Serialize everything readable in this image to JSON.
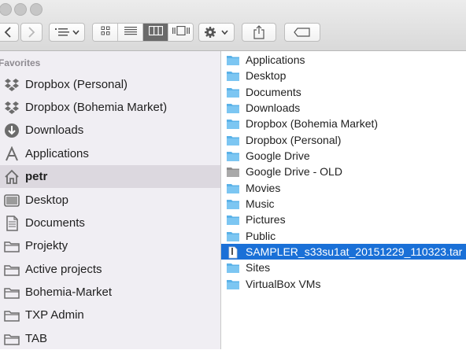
{
  "toolbar": {
    "back_icon": "chevron-left-icon",
    "forward_icon": "chevron-right-icon",
    "arrange_icon": "list-arrange-icon",
    "view_modes": [
      "icon-view",
      "list-view",
      "column-view",
      "cover-flow-view"
    ],
    "active_view": "column-view",
    "action_icon": "gear-icon",
    "share_icon": "share-icon",
    "tag_icon": "tag-icon"
  },
  "sidebar": {
    "section_title": "Favorites",
    "items": [
      {
        "label": "Dropbox (Personal)",
        "icon": "dropbox-icon"
      },
      {
        "label": "Dropbox (Bohemia Market)",
        "icon": "dropbox-icon"
      },
      {
        "label": "Downloads",
        "icon": "download-icon"
      },
      {
        "label": "Applications",
        "icon": "applications-icon"
      },
      {
        "label": "petr",
        "icon": "home-icon",
        "selected": true
      },
      {
        "label": "Desktop",
        "icon": "desktop-icon"
      },
      {
        "label": "Documents",
        "icon": "document-icon"
      },
      {
        "label": "Projekty",
        "icon": "folder-icon"
      },
      {
        "label": "Active projects",
        "icon": "folder-icon"
      },
      {
        "label": "Bohemia-Market",
        "icon": "folder-icon"
      },
      {
        "label": "TXP Admin",
        "icon": "folder-icon"
      },
      {
        "label": "TAB",
        "icon": "folder-icon"
      }
    ]
  },
  "files": [
    {
      "name": "Applications",
      "icon": "folder-icon"
    },
    {
      "name": "Desktop",
      "icon": "folder-icon"
    },
    {
      "name": "Documents",
      "icon": "folder-icon"
    },
    {
      "name": "Downloads",
      "icon": "folder-icon"
    },
    {
      "name": "Dropbox (Bohemia Market)",
      "icon": "folder-icon"
    },
    {
      "name": "Dropbox (Personal)",
      "icon": "folder-icon"
    },
    {
      "name": "Google Drive",
      "icon": "folder-icon"
    },
    {
      "name": "Google Drive - OLD",
      "icon": "folder-gray-icon"
    },
    {
      "name": "Movies",
      "icon": "folder-icon"
    },
    {
      "name": "Music",
      "icon": "folder-icon"
    },
    {
      "name": "Pictures",
      "icon": "folder-icon"
    },
    {
      "name": "Public",
      "icon": "folder-icon"
    },
    {
      "name": "SAMPLER_s33su1at_20151229_110323.tar",
      "icon": "file-icon",
      "selected": true
    },
    {
      "name": "Sites",
      "icon": "folder-icon"
    },
    {
      "name": "VirtualBox VMs",
      "icon": "folder-icon"
    }
  ],
  "colors": {
    "selection_blue": "#1a70d7",
    "folder_blue": "#5ab2e8",
    "sidebar_bg": "#f0eef3",
    "sidebar_selected": "#dcd8df"
  }
}
